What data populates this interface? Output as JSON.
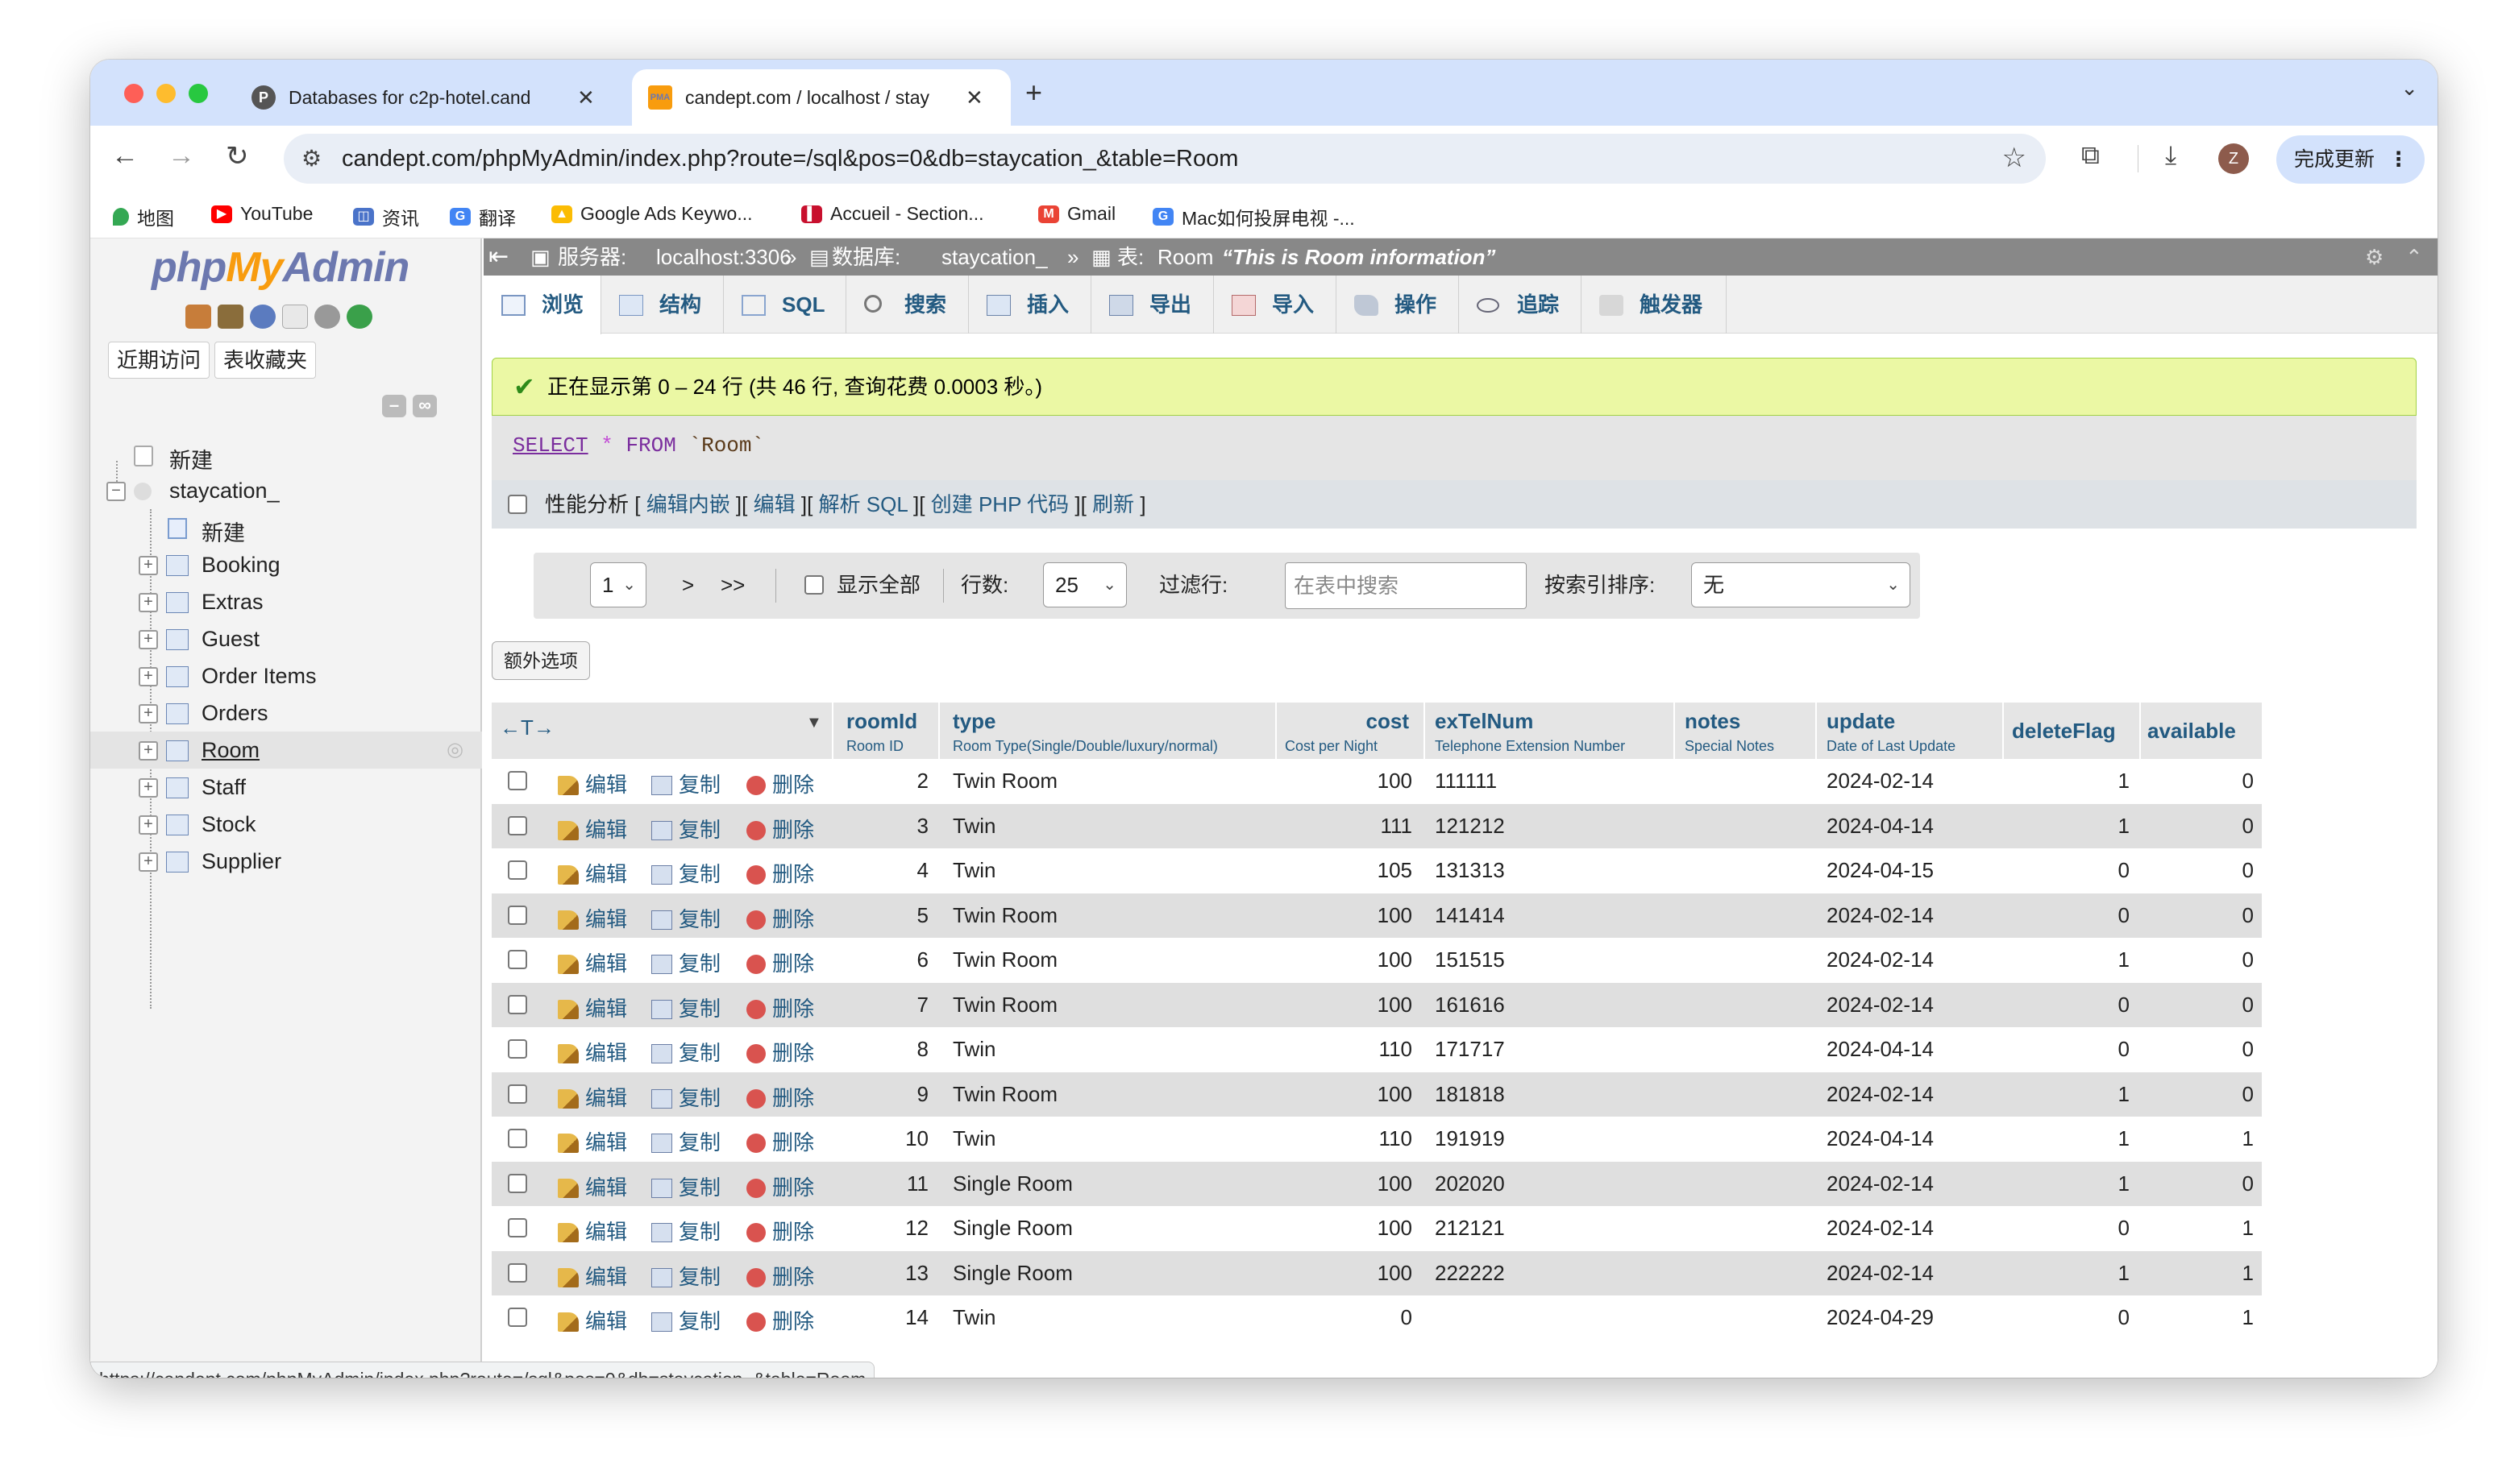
{
  "browser": {
    "tabs": [
      {
        "title": "Databases for c2p-hotel.cand",
        "favicon": "P"
      },
      {
        "title": "candept.com / localhost / stay",
        "favicon": "PMA"
      }
    ],
    "url": "candept.com/phpMyAdmin/index.php?route=/sql&pos=0&db=staycation_&table=Room",
    "avatar_letter": "Z",
    "update_label": "完成更新",
    "bookmarks": [
      "地图",
      "YouTube",
      "资讯",
      "翻译",
      "Google Ads Keywo...",
      "Accueil - Section...",
      "Gmail",
      "Mac如何投屏电视 -..."
    ],
    "status_url": "https://candept.com/phpMyAdmin/index.php?route=/sql&pos=0&db=staycation_&table=Room"
  },
  "sidebar": {
    "logo": {
      "php": "php",
      "my": "My",
      "admin": "Admin"
    },
    "tabs": [
      "近期访问",
      "表收藏夹"
    ],
    "new_label": "新建",
    "database": "staycation_",
    "db_new_label": "新建",
    "tables": [
      "Booking",
      "Extras",
      "Guest",
      "Order Items",
      "Orders",
      "Room",
      "Staff",
      "Stock",
      "Supplier"
    ],
    "active_table": "Room"
  },
  "breadcrumb": {
    "server_label": "服务器:",
    "server": "localhost:3306",
    "db_label": "数据库:",
    "db": "staycation_",
    "table_label": "表:",
    "table": "Room",
    "comment": "“This is Room information”"
  },
  "menu": [
    "浏览",
    "结构",
    "SQL",
    "搜索",
    "插入",
    "导出",
    "导入",
    "操作",
    "追踪",
    "触发器"
  ],
  "message": "正在显示第 0 – 24 行 (共 46 行, 查询花费 0.0003 秒。)",
  "sql": {
    "select": "SELECT",
    "star": "*",
    "from": "FROM",
    "table": "`Room`"
  },
  "profiling": {
    "label": "性能分析",
    "links": [
      "编辑内嵌",
      "编辑",
      "解析 SQL",
      "创建 PHP 代码",
      "刷新"
    ]
  },
  "nav": {
    "page": "1",
    "next": ">",
    "last": ">>",
    "show_all": "显示全部",
    "rows_label": "行数:",
    "rows_value": "25",
    "filter_label": "过滤行:",
    "filter_placeholder": "在表中搜索",
    "sort_label": "按索引排序:",
    "sort_value": "无"
  },
  "extra_options": "额外选项",
  "table": {
    "arrows": "←T→",
    "columns": [
      {
        "name": "roomId",
        "comment": "Room ID"
      },
      {
        "name": "type",
        "comment": "Room Type(Single/Double/luxury/normal)"
      },
      {
        "name": "cost",
        "comment": "Cost per Night"
      },
      {
        "name": "exTelNum",
        "comment": "Telephone Extension Number"
      },
      {
        "name": "notes",
        "comment": "Special Notes"
      },
      {
        "name": "update",
        "comment": "Date of Last Update"
      },
      {
        "name": "deleteFlag",
        "comment": ""
      },
      {
        "name": "available",
        "comment": ""
      }
    ],
    "actions": {
      "edit": "编辑",
      "copy": "复制",
      "delete": "删除"
    },
    "rows": [
      [
        "2",
        "Twin Room",
        "100",
        "111111",
        "",
        "2024-02-14",
        "1",
        "0"
      ],
      [
        "3",
        "Twin",
        "111",
        "121212",
        "",
        "2024-04-14",
        "1",
        "0"
      ],
      [
        "4",
        "Twin",
        "105",
        "131313",
        "",
        "2024-04-15",
        "0",
        "0"
      ],
      [
        "5",
        "Twin Room",
        "100",
        "141414",
        "",
        "2024-02-14",
        "0",
        "0"
      ],
      [
        "6",
        "Twin Room",
        "100",
        "151515",
        "",
        "2024-02-14",
        "1",
        "0"
      ],
      [
        "7",
        "Twin Room",
        "100",
        "161616",
        "",
        "2024-02-14",
        "0",
        "0"
      ],
      [
        "8",
        "Twin",
        "110",
        "171717",
        "",
        "2024-04-14",
        "0",
        "0"
      ],
      [
        "9",
        "Twin Room",
        "100",
        "181818",
        "",
        "2024-02-14",
        "1",
        "0"
      ],
      [
        "10",
        "Twin",
        "110",
        "191919",
        "",
        "2024-04-14",
        "1",
        "1"
      ],
      [
        "11",
        "Single Room",
        "100",
        "202020",
        "",
        "2024-02-14",
        "1",
        "0"
      ],
      [
        "12",
        "Single Room",
        "100",
        "212121",
        "",
        "2024-02-14",
        "0",
        "1"
      ],
      [
        "13",
        "Single Room",
        "100",
        "222222",
        "",
        "2024-02-14",
        "1",
        "1"
      ],
      [
        "14",
        "Twin",
        "0",
        "",
        "",
        "2024-04-29",
        "0",
        "1"
      ]
    ]
  },
  "colors": {
    "pma_blue": "#235a81",
    "success_bg": "#ebf8a4",
    "tab_strip": "#d3e2fc"
  }
}
